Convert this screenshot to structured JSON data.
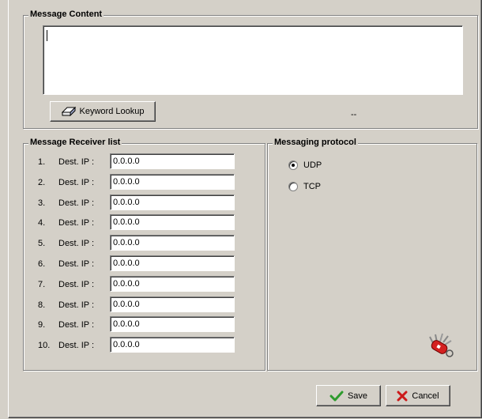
{
  "message_content": {
    "legend": "Message Content",
    "text": "",
    "keyword_button": "Keyword Lookup",
    "status": "--"
  },
  "receivers": {
    "legend": "Message Receiver list",
    "items": [
      {
        "num": "1.",
        "label": "Dest. IP :",
        "value": "0.0.0.0"
      },
      {
        "num": "2.",
        "label": "Dest. IP :",
        "value": "0.0.0.0"
      },
      {
        "num": "3.",
        "label": "Dest. IP :",
        "value": "0.0.0.0"
      },
      {
        "num": "4.",
        "label": "Dest. IP :",
        "value": "0.0.0.0"
      },
      {
        "num": "5.",
        "label": "Dest. IP :",
        "value": "0.0.0.0"
      },
      {
        "num": "6.",
        "label": "Dest. IP :",
        "value": "0.0.0.0"
      },
      {
        "num": "7.",
        "label": "Dest. IP :",
        "value": "0.0.0.0"
      },
      {
        "num": "8.",
        "label": "Dest. IP :",
        "value": "0.0.0.0"
      },
      {
        "num": "9.",
        "label": "Dest. IP :",
        "value": "0.0.0.0"
      },
      {
        "num": "10.",
        "label": "Dest. IP :",
        "value": "0.0.0.0"
      }
    ]
  },
  "protocol": {
    "legend": "Messaging protocol",
    "options": [
      {
        "label": "UDP",
        "selected": true
      },
      {
        "label": "TCP",
        "selected": false
      }
    ],
    "tool_icon": "swiss-knife-icon"
  },
  "footer": {
    "save_label": "Save",
    "cancel_label": "Cancel"
  },
  "colors": {
    "face": "#d4d0c8",
    "save_check": "#2e9b2e",
    "cancel_x": "#cc1a1a"
  }
}
